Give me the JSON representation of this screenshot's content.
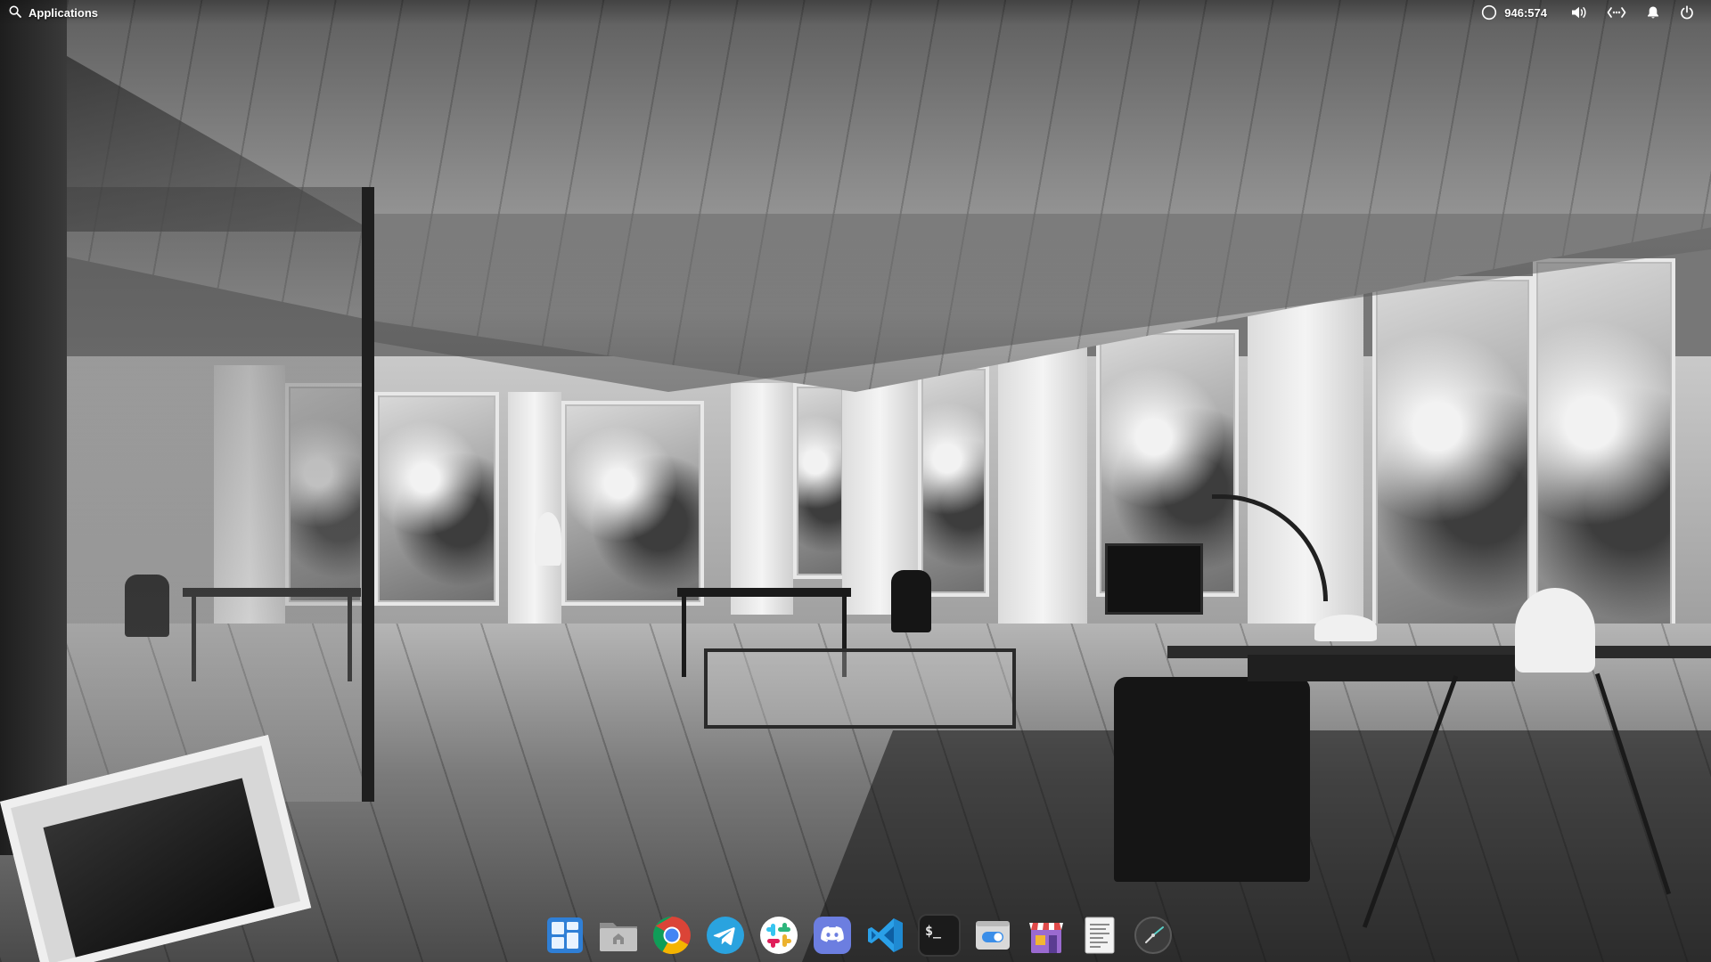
{
  "top_panel": {
    "applications_label": "Applications",
    "applications_icon": "search-icon",
    "indicators": [
      {
        "id": "clock",
        "icon": "circle-clock-icon",
        "label": "946:574"
      },
      {
        "id": "sound",
        "icon": "speaker-icon"
      },
      {
        "id": "network",
        "icon": "network-wired-icon"
      },
      {
        "id": "notifications",
        "icon": "bell-icon"
      },
      {
        "id": "session",
        "icon": "power-icon"
      }
    ]
  },
  "dock": {
    "items": [
      {
        "name": "multitasking-view",
        "icon": "multitasking-icon",
        "running": false
      },
      {
        "name": "files",
        "icon": "folder-home-icon",
        "running": false
      },
      {
        "name": "google-chrome",
        "icon": "chrome-icon",
        "running": true
      },
      {
        "name": "telegram",
        "icon": "telegram-icon",
        "running": true
      },
      {
        "name": "slack",
        "icon": "slack-icon",
        "running": true
      },
      {
        "name": "discord",
        "icon": "discord-icon",
        "running": false
      },
      {
        "name": "visual-studio-code",
        "icon": "vscode-icon",
        "running": true
      },
      {
        "name": "terminal",
        "icon": "terminal-icon",
        "running": false,
        "text": "$_"
      },
      {
        "name": "system-settings",
        "icon": "settings-toggle-icon",
        "running": false
      },
      {
        "name": "appcenter",
        "icon": "appcenter-store-icon",
        "running": false
      },
      {
        "name": "text-editor",
        "icon": "document-icon",
        "running": false
      },
      {
        "name": "clock-app",
        "icon": "clock-icon",
        "running": false
      }
    ]
  },
  "colors": {
    "running_indicator": "#5aa7ff",
    "panel_text": "#ffffff",
    "chrome_red": "#db4437",
    "chrome_green": "#0f9d58",
    "chrome_yellow": "#f4b400",
    "chrome_blue": "#4285f4",
    "telegram_blue": "#2aa3df",
    "discord_blurple": "#6c7ee0",
    "vscode_blue": "#1f8ad2"
  }
}
